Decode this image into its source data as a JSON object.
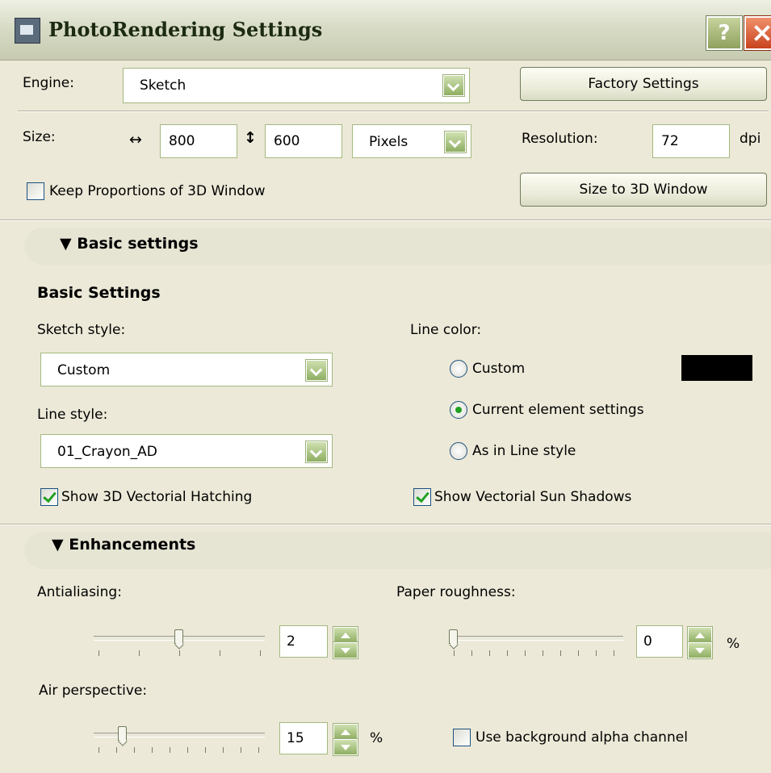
{
  "window": {
    "title": "PhotoRendering Settings",
    "help_label": "?"
  },
  "engine": {
    "label": "Engine:",
    "value": "Sketch",
    "factory_button": "Factory Settings"
  },
  "size": {
    "label": "Size:",
    "width_icon": "↔",
    "width": "800",
    "height_icon": "↕",
    "height": "600",
    "unit": "Pixels",
    "resolution_label": "Resolution:",
    "resolution": "72",
    "resolution_unit": "dpi",
    "keep_proportions_label": "Keep Proportions of 3D Window",
    "keep_proportions": false,
    "size_to_window_button": "Size to 3D Window"
  },
  "basic_panel": {
    "header": "▼ Basic settings",
    "title": "Basic Settings",
    "sketch_style_label": "Sketch style:",
    "sketch_style": "Custom",
    "line_style_label": "Line style:",
    "line_style": "01_Crayon_AD",
    "line_color_label": "Line color:",
    "line_color_options": [
      {
        "label": "Custom",
        "selected": false
      },
      {
        "label": "Current element settings",
        "selected": true
      },
      {
        "label": "As in Line style",
        "selected": false
      }
    ],
    "custom_color": "#000000",
    "show_hatching_label": "Show 3D Vectorial Hatching",
    "show_hatching": true,
    "show_sun_shadows_label": "Show Vectorial Sun Shadows",
    "show_sun_shadows": true
  },
  "enhancements_panel": {
    "header": "▼ Enhancements",
    "antialiasing_label": "Antialiasing:",
    "antialiasing_value": "2",
    "antialiasing_level": 0.5,
    "paper_roughness_label": "Paper roughness:",
    "paper_roughness_value": "0",
    "paper_roughness_unit": "%",
    "paper_roughness_level": 0,
    "air_perspective_label": "Air perspective:",
    "air_perspective_value": "15",
    "air_perspective_unit": "%",
    "air_perspective_level": 0.15,
    "alpha_channel_label": "Use background alpha channel",
    "alpha_channel": false
  },
  "colors": {
    "title_text": "#1c2a12",
    "accent_green": "#21a121",
    "field_border": "#a4b97f"
  }
}
